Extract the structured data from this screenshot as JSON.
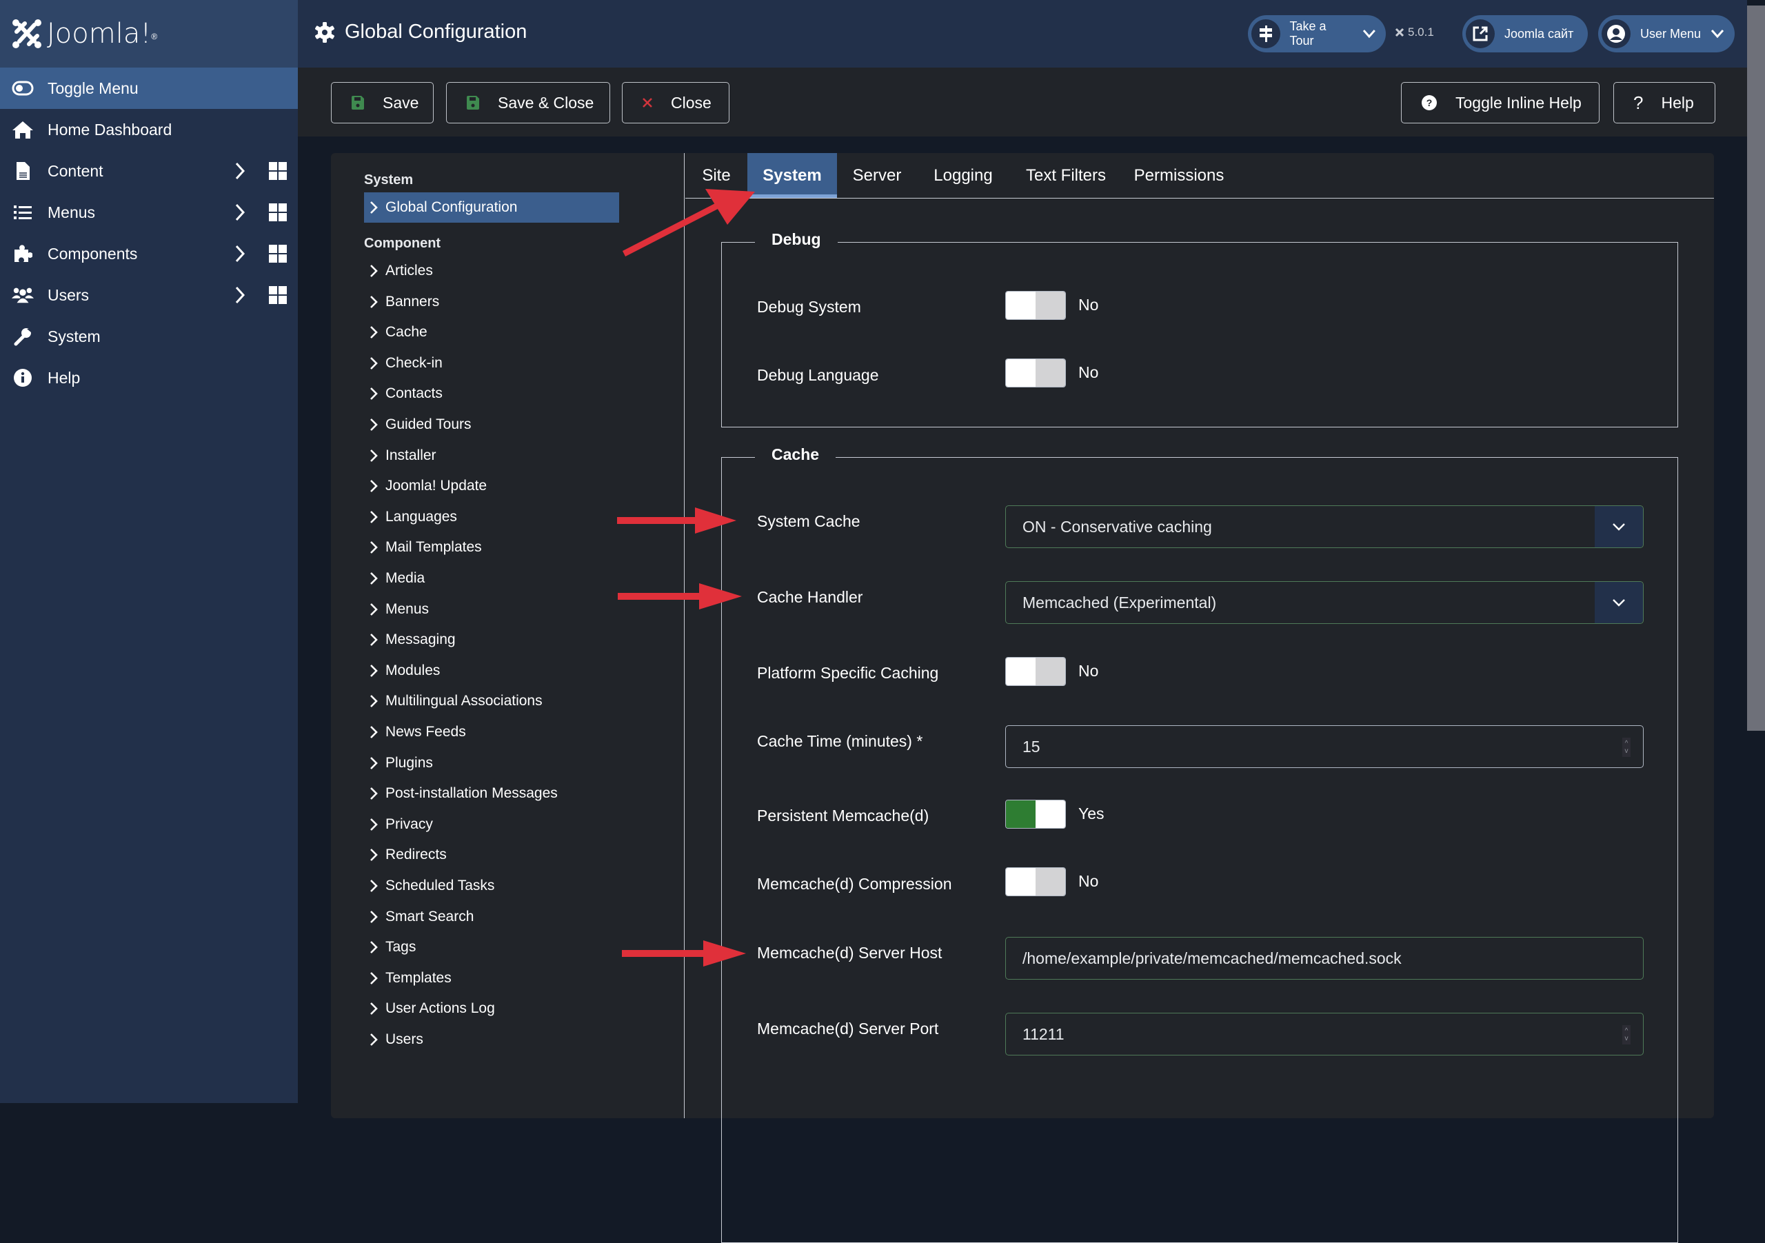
{
  "app": {
    "logo_text": "Joomla!",
    "page_title": "Global Configuration"
  },
  "header": {
    "take_tour": "Take a Tour",
    "version": "5.0.1",
    "site_link": "Joomla сайт",
    "user_menu": "User Menu"
  },
  "sidebar": {
    "items": [
      {
        "label": "Toggle Menu",
        "icon": "toggle-icon"
      },
      {
        "label": "Home Dashboard",
        "icon": "home-icon"
      },
      {
        "label": "Content",
        "icon": "file-icon"
      },
      {
        "label": "Menus",
        "icon": "list-icon"
      },
      {
        "label": "Components",
        "icon": "puzzle-icon"
      },
      {
        "label": "Users",
        "icon": "users-icon"
      },
      {
        "label": "System",
        "icon": "wrench-icon"
      },
      {
        "label": "Help",
        "icon": "info-icon"
      }
    ]
  },
  "toolbar": {
    "save": "Save",
    "save_close": "Save & Close",
    "close": "Close",
    "toggle_inline_help": "Toggle Inline Help",
    "help": "Help"
  },
  "leftnav": {
    "system_heading": "System",
    "system_items": [
      "Global Configuration"
    ],
    "component_heading": "Component",
    "component_items": [
      "Articles",
      "Banners",
      "Cache",
      "Check-in",
      "Contacts",
      "Guided Tours",
      "Installer",
      "Joomla! Update",
      "Languages",
      "Mail Templates",
      "Media",
      "Menus",
      "Messaging",
      "Modules",
      "Multilingual Associations",
      "News Feeds",
      "Plugins",
      "Post-installation Messages",
      "Privacy",
      "Redirects",
      "Scheduled Tasks",
      "Smart Search",
      "Tags",
      "Templates",
      "User Actions Log",
      "Users"
    ]
  },
  "tabs": [
    "Site",
    "System",
    "Server",
    "Logging",
    "Text Filters",
    "Permissions"
  ],
  "active_tab": "System",
  "debug": {
    "legend": "Debug",
    "debug_system": {
      "label": "Debug System",
      "value": "No"
    },
    "debug_language": {
      "label": "Debug Language",
      "value": "No"
    }
  },
  "cache": {
    "legend": "Cache",
    "system_cache": {
      "label": "System Cache",
      "value": "ON - Conservative caching"
    },
    "cache_handler": {
      "label": "Cache Handler",
      "value": "Memcached (Experimental)"
    },
    "platform_specific": {
      "label": "Platform Specific Caching",
      "value": "No"
    },
    "cache_time": {
      "label": "Cache Time (minutes) *",
      "value": "15"
    },
    "persistent": {
      "label": "Persistent Memcache(d)",
      "value": "Yes"
    },
    "compression": {
      "label": "Memcache(d) Compression",
      "value": "No"
    },
    "server_host": {
      "label": "Memcache(d) Server Host",
      "value": "/home/example/private/memcached/memcached.sock"
    },
    "server_port": {
      "label": "Memcache(d) Server Port",
      "value": "11211"
    }
  },
  "colors": {
    "accent": "#3b5e8d",
    "header_bg": "#22304a",
    "toggle_on": "#2e7d32",
    "annotation_arrow": "#e0303a"
  }
}
